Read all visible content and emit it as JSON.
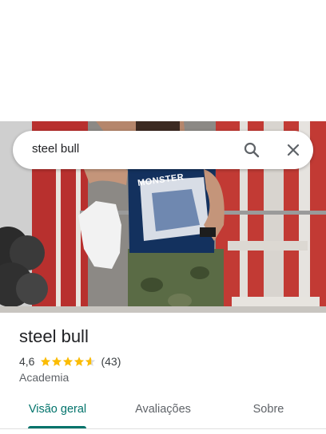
{
  "search": {
    "query": "steel bull"
  },
  "place": {
    "name": "steel bull",
    "rating": "4,6",
    "rating_value": 4.6,
    "review_count": "(43)",
    "category": "Academia",
    "photo_print_text": "MONSTER"
  },
  "tabs": [
    {
      "label": "Visão geral",
      "active": true
    },
    {
      "label": "Avaliações",
      "active": false
    },
    {
      "label": "Sobre",
      "active": false
    }
  ],
  "colors": {
    "accent": "#01736b",
    "star": "#fbbc04",
    "text_primary": "#202124",
    "text_secondary": "#5f6368"
  },
  "icons": [
    "search-icon",
    "close-icon",
    "star-icon"
  ]
}
